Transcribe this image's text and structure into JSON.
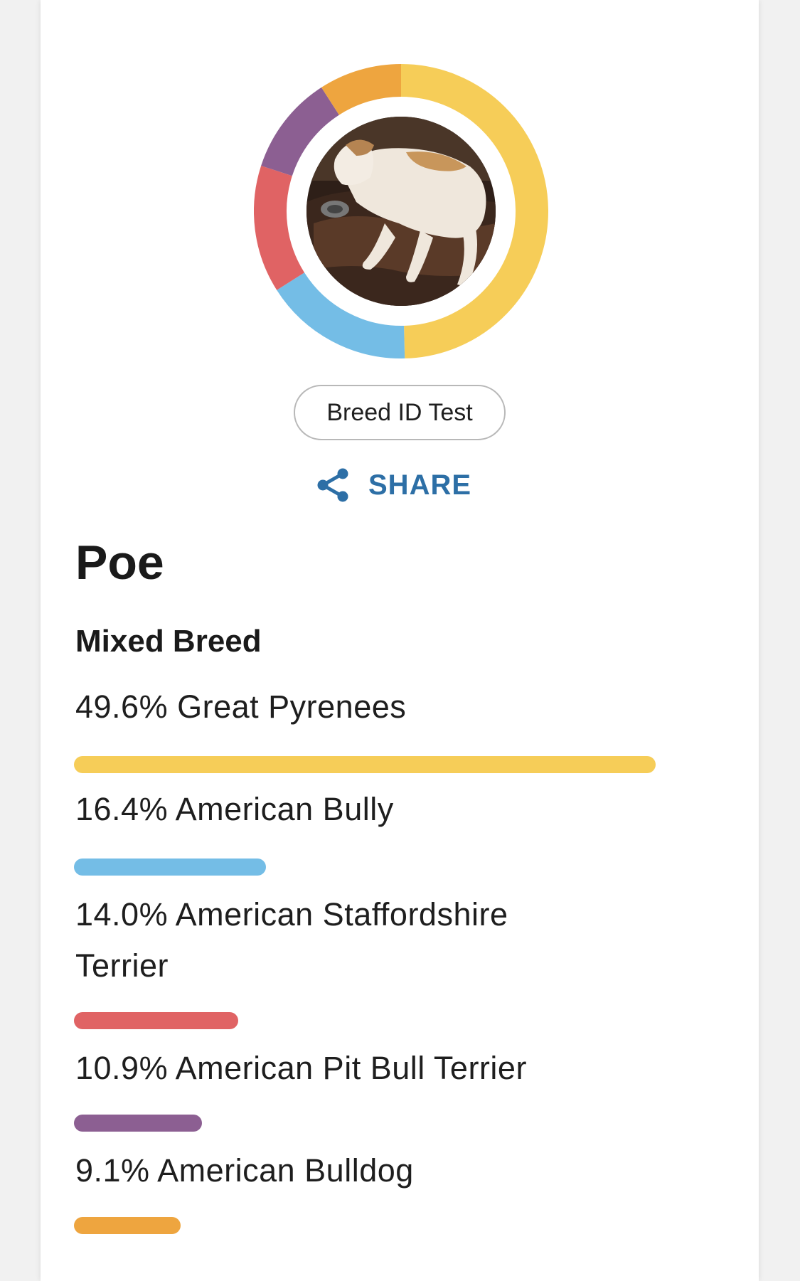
{
  "test_badge": "Breed ID Test",
  "share": {
    "label": "SHARE",
    "icon": "share-icon"
  },
  "pet": {
    "name": "Poe",
    "breed_type": "Mixed Breed"
  },
  "breeds": [
    {
      "label": "49.6% Great Pyrenees",
      "percent": 49.6,
      "color": "#f6cd58"
    },
    {
      "label": "16.4% American Bully",
      "percent": 16.4,
      "color": "#74bde6"
    },
    {
      "label": "14.0% American Staffordshire Terrier",
      "percent": 14.0,
      "color": "#e06364"
    },
    {
      "label": "10.9% American Pit Bull Terrier",
      "percent": 10.9,
      "color": "#8c5f92"
    },
    {
      "label": "9.1% American Bulldog",
      "percent": 9.1,
      "color": "#eea53f"
    }
  ]
}
